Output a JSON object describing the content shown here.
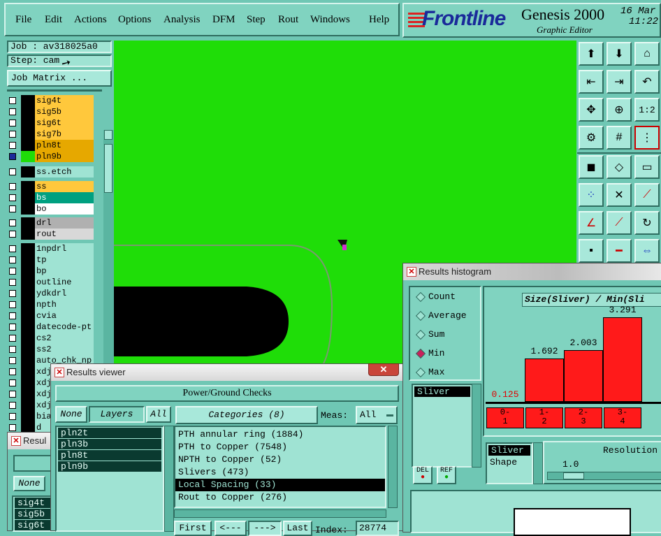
{
  "menu": {
    "items": [
      "File",
      "Edit",
      "Actions",
      "Options",
      "Analysis",
      "DFM",
      "Step",
      "Rout",
      "Windows",
      "Help"
    ]
  },
  "branding": {
    "logo": "Frontline",
    "product": "Genesis 2000",
    "subtitle": "Graphic Editor",
    "date": "16 Mar",
    "time": "11:22"
  },
  "job": {
    "job_label": "Job : av318025a0",
    "step_label": "Step: cam",
    "matrix_button": "Job Matrix ..."
  },
  "layers": [
    {
      "name": "sig4t",
      "color": "#ffc83c",
      "dot": false
    },
    {
      "name": "sig5b",
      "color": "#ffc83c",
      "dot": false
    },
    {
      "name": "sig6t",
      "color": "#ffc83c",
      "dot": false
    },
    {
      "name": "sig7b",
      "color": "#ffc83c",
      "dot": false
    },
    {
      "name": "pln8t",
      "color": "#e6a800",
      "dot": false
    },
    {
      "name": "pln9b",
      "color": "#e6a800",
      "dot": true
    },
    {
      "name": "ss.etch",
      "color": "#9fe3d3",
      "dot": false
    },
    {
      "name": "ss",
      "color": "#ffc83c",
      "dot": false
    },
    {
      "name": "bs",
      "color": "#00a080",
      "dot": false
    },
    {
      "name": "bo",
      "color": "#ffffff",
      "dot": false
    },
    {
      "name": "drl",
      "color": "#b0b0b0",
      "dot": false
    },
    {
      "name": "rout",
      "color": "#d8d8d8",
      "dot": false
    },
    {
      "name": "1npdrl",
      "color": "#9fe3d3",
      "dot": false
    },
    {
      "name": "tp",
      "color": "#9fe3d3",
      "dot": false
    },
    {
      "name": "bp",
      "color": "#9fe3d3",
      "dot": false
    },
    {
      "name": "outline",
      "color": "#9fe3d3",
      "dot": false
    },
    {
      "name": "ydkdrl",
      "color": "#9fe3d3",
      "dot": false
    },
    {
      "name": "npth",
      "color": "#9fe3d3",
      "dot": false
    },
    {
      "name": "cvia",
      "color": "#9fe3d3",
      "dot": false
    },
    {
      "name": "datecode-pt",
      "color": "#9fe3d3",
      "dot": false
    },
    {
      "name": "cs2",
      "color": "#9fe3d3",
      "dot": false
    },
    {
      "name": "ss2",
      "color": "#9fe3d3",
      "dot": false
    },
    {
      "name": "auto_chk_np",
      "color": "#9fe3d3",
      "dot": false
    },
    {
      "name": "xdj",
      "color": "#9fe3d3",
      "dot": false
    },
    {
      "name": "xdj",
      "color": "#9fe3d3",
      "dot": false
    },
    {
      "name": "xdj",
      "color": "#9fe3d3",
      "dot": false
    },
    {
      "name": "xdj",
      "color": "#9fe3d3",
      "dot": false
    },
    {
      "name": "bia",
      "color": "#9fe3d3",
      "dot": false
    },
    {
      "name": "d",
      "color": "#9fe3d3",
      "dot": false
    }
  ],
  "results_viewer": {
    "title": "Results viewer",
    "header": "Power/Ground Checks",
    "none_button": "None",
    "layers_label": "Layers",
    "all_button": "All",
    "layer_list": [
      "pln2t",
      "pln3b",
      "pln8t",
      "pln9b"
    ],
    "categories_label": "Categories (8)",
    "meas_label": "Meas:",
    "meas_value": "All",
    "categories": [
      "PTH annular ring (1884)",
      "PTH to Copper (7548)",
      "NPTH to Copper (52)",
      "Slivers (473)",
      "Local Spacing (33)",
      "Rout to Copper (276)"
    ],
    "selected_category": 4,
    "first_button": "First",
    "prev_button": "<---",
    "next_button": "--->",
    "last_button": "Last",
    "index_label": "Index:",
    "index_value": "28774"
  },
  "back_window": {
    "title": "Resul",
    "none_button": "None",
    "list": [
      "sig4t",
      "sig5b",
      "sig6t"
    ]
  },
  "histogram_window": {
    "title": "Results histogram",
    "modes": [
      "Count",
      "Average",
      "Sum",
      "Min",
      "Max"
    ],
    "selected_mode": "Min",
    "list": [
      "Sliver"
    ],
    "del_button": "DEL",
    "ref_button": "REF",
    "lower_list": [
      "Sliver",
      "Shape"
    ],
    "resolution_label": "Resolution",
    "resolution_value": "1.0"
  },
  "chart_data": {
    "type": "bar",
    "title": "Size(Sliver) / Min(Sli",
    "categories": [
      "0-1",
      "1-2",
      "2-3",
      "3-4"
    ],
    "values": [
      0.125,
      1.692,
      2.003,
      3.291
    ],
    "value_labels": [
      "0.125",
      "1.692",
      "2.003",
      "3.291"
    ],
    "ylim": [
      0,
      3.7
    ]
  }
}
